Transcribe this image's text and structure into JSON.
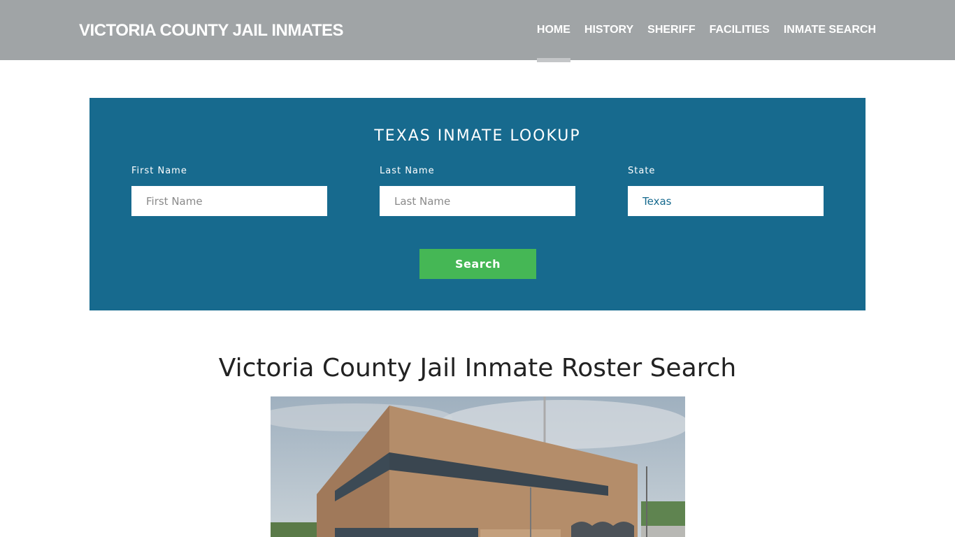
{
  "header": {
    "brand": "VICTORIA COUNTY JAIL INMATES",
    "nav": [
      {
        "label": "HOME",
        "active": true
      },
      {
        "label": "HISTORY"
      },
      {
        "label": "SHERIFF"
      },
      {
        "label": "FACILITIES"
      },
      {
        "label": "INMATE SEARCH"
      }
    ]
  },
  "lookup": {
    "title": "TEXAS INMATE LOOKUP",
    "first_name": {
      "label": "First Name",
      "placeholder": "First Name",
      "value": ""
    },
    "last_name": {
      "label": "Last Name",
      "placeholder": "Last Name",
      "value": ""
    },
    "state": {
      "label": "State",
      "value": "Texas"
    },
    "search_label": "Search",
    "background_color": "#176a8e",
    "button_color": "#45b755"
  },
  "main": {
    "title": "Victoria County Jail Inmate Roster Search"
  }
}
